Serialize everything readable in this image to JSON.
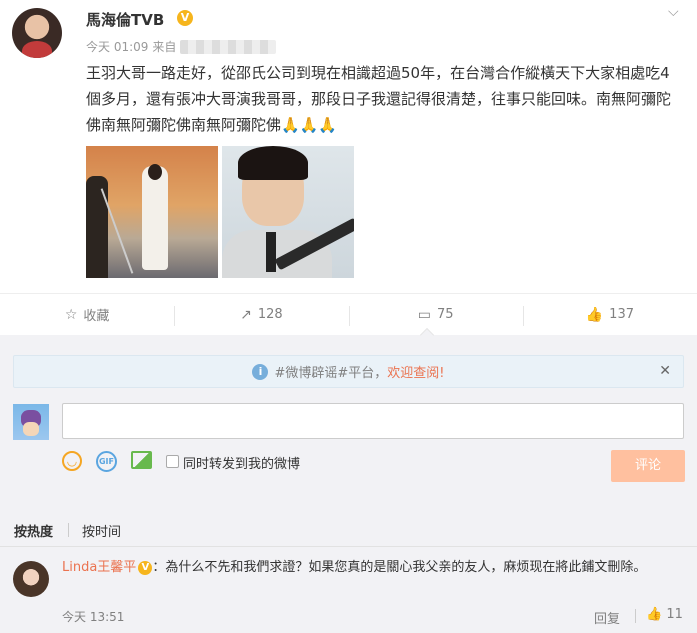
{
  "post": {
    "user_name": "馬海倫TVB",
    "verified_badge": "V",
    "time": "今天 01:09",
    "source_prefix": "来自",
    "text": "王羽大哥一路走好，從邵氏公司到現在相識超過50年，在台灣合作縱橫天下大家相處吃4個多月，還有張冲大哥演我哥哥，那段日子我還記得很清楚，往事只能回味。南無阿彌陀佛南無阿彌陀佛南無阿彌陀佛",
    "emoji": "🙏🙏🙏"
  },
  "actions": {
    "favorite_label": "收藏",
    "repost_count": "128",
    "comment_count": "75",
    "like_count": "137"
  },
  "notice": {
    "text_prefix": "#微博辟谣#平台，",
    "link_text": "欢迎查阅!"
  },
  "composer": {
    "input_value": "",
    "also_repost_label": "同时转发到我的微博",
    "submit_label": "评论"
  },
  "sort": {
    "hot_label": "按热度",
    "time_label": "按时间"
  },
  "comments": [
    {
      "user_name": "Linda王馨平",
      "text": "：為什么不先和我們求證？如果您真的是關心我父亲的友人，麻烦现在將此鋪文刪除。",
      "time": "今天 13:51",
      "reply_label": "回复",
      "like_count": "11"
    }
  ],
  "colors": {
    "accent_orange": "#eb7350",
    "verified_gold": "#f6b51d",
    "submit_disabled": "#ffc09f",
    "comment_bg": "#f2f2f5"
  }
}
